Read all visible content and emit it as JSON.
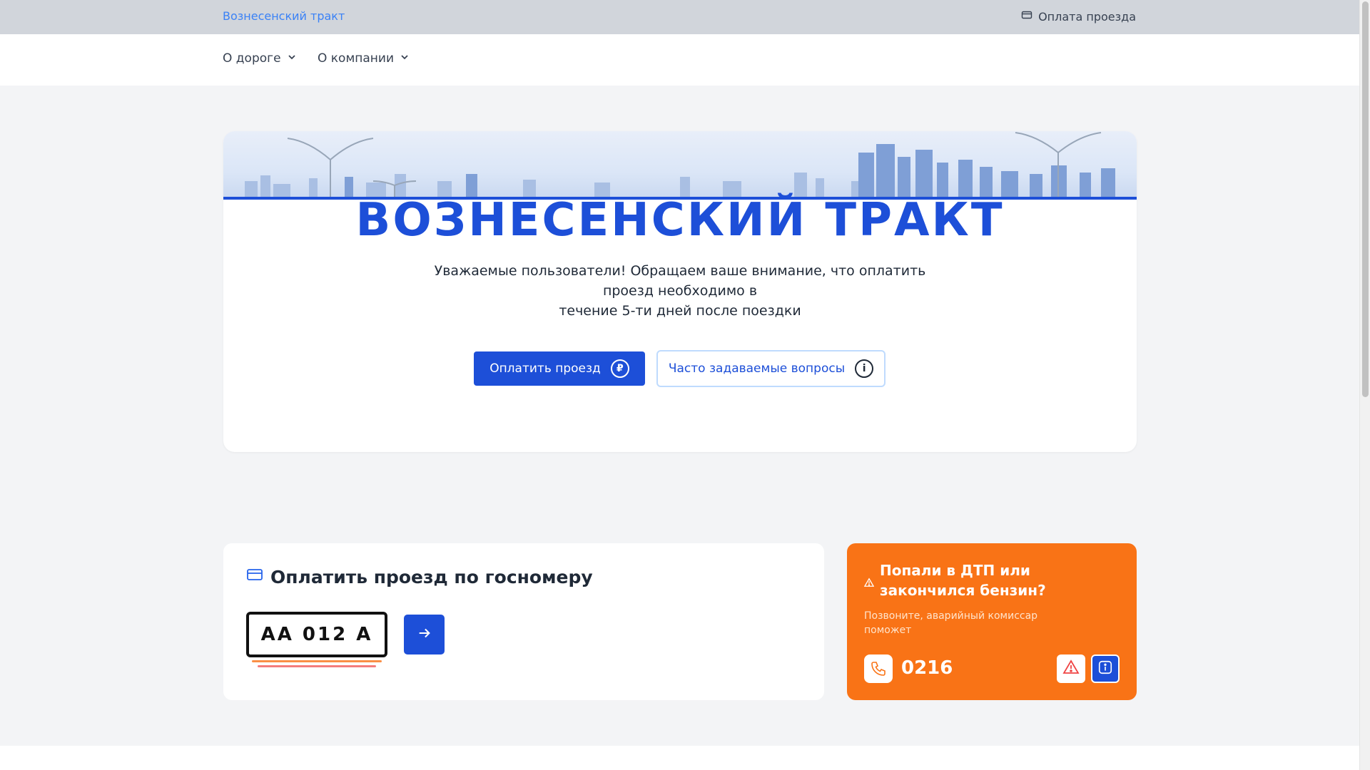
{
  "topbar": {
    "brand": "Вознесенский тракт",
    "pay_link": "Оплата проезда"
  },
  "nav": {
    "items": [
      {
        "label": "О дороге"
      },
      {
        "label": "О компании"
      }
    ]
  },
  "hero": {
    "title": "ВОЗНЕСЕНСКИЙ ТРАКТ",
    "text_line1": "Уважаемые пользователи! Обращаем ваше внимание, что оплатить проезд необходимо в",
    "text_line2": "течение 5-ти дней после поездки",
    "primary_button": "Оплатить проезд",
    "primary_icon_glyph": "₽",
    "secondary_button": "Часто задаваемые вопросы",
    "secondary_icon_glyph": "i"
  },
  "plate_card": {
    "title": "Оплатить проезд по госномеру",
    "plate_value": "AA 012 A"
  },
  "accident_card": {
    "title": "Попали в ДТП или закончился бензин?",
    "subtitle": "Позвоните, аварийный комиссар поможет",
    "phone": "0216"
  },
  "colors": {
    "brand_blue": "#1d4fd8",
    "accent_orange": "#f97316",
    "topbar_bg": "#d1d5db"
  }
}
